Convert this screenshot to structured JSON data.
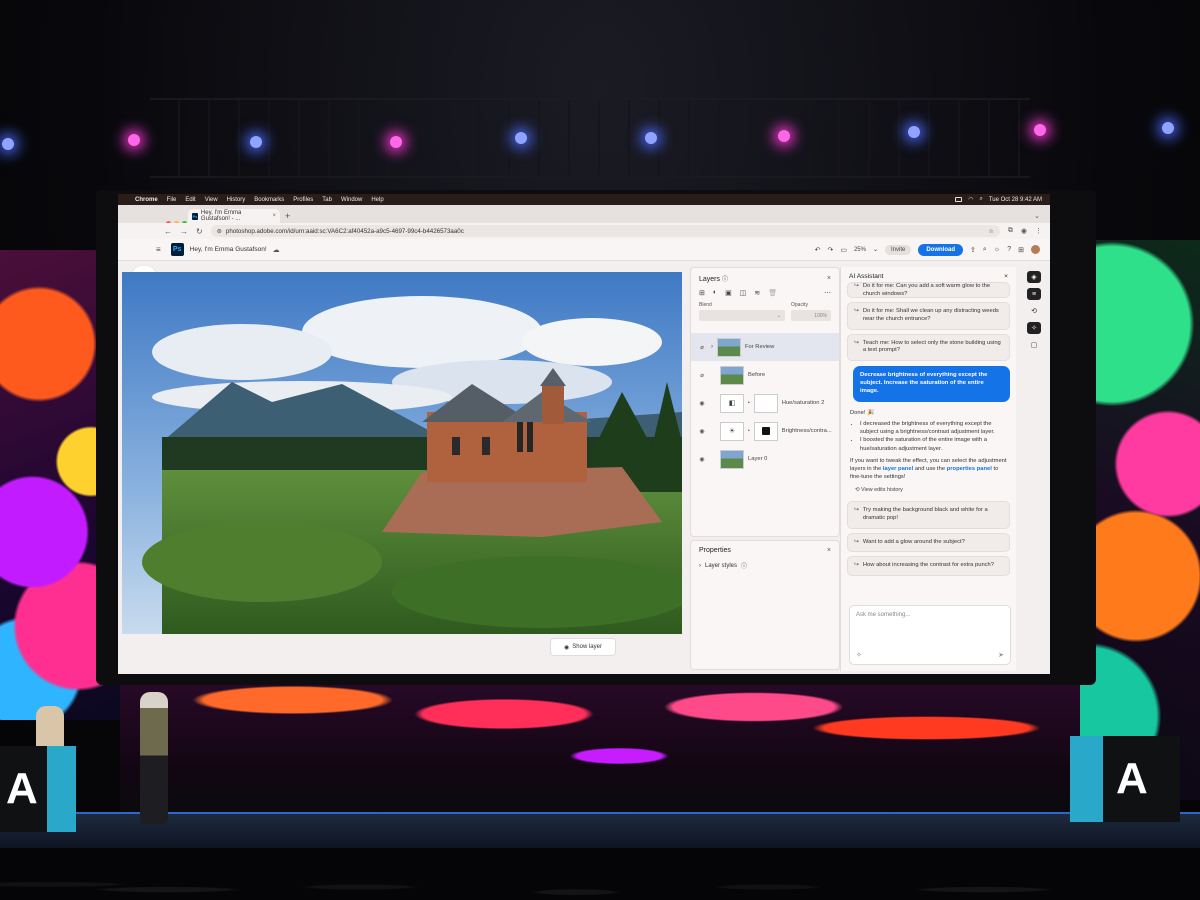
{
  "menubar": {
    "apple": "",
    "app": "Chrome",
    "items": [
      "File",
      "Edit",
      "View",
      "History",
      "Bookmarks",
      "Profiles",
      "Tab",
      "Window",
      "Help"
    ],
    "datetime": "Tue Oct 28  9:42 AM"
  },
  "browser": {
    "tab_title": "Hey, I'm Emma Gustafson! - ...",
    "favicon": "Ps",
    "url": "photoshop.adobe.com/id/urn:aaid:sc:VA6C2:af40452a-a9c5-4697-99c4-b4426573aa0c"
  },
  "ps_header": {
    "logo": "Ps",
    "title": "Hey, I'm Emma Gustafson!",
    "zoom": "25%",
    "invite": "Invite",
    "download": "Download"
  },
  "toolbar": {
    "tools": [
      "select-icon",
      "quick-select-icon",
      "object-select-icon",
      "brush-select-icon",
      "healing-icon",
      "clone-icon",
      "fill-icon",
      "crop-icon",
      "shape-icon",
      "type-icon",
      "pen-icon",
      "eyedropper-icon",
      "ellipse-icon",
      "swap-icon",
      "color-swatch"
    ]
  },
  "canvas": {
    "show_layer": "Show layer"
  },
  "layers_panel": {
    "title": "Layers",
    "blend_label": "Blend",
    "opacity_label": "Opacity",
    "opacity_value": "100%",
    "layers": [
      {
        "name": "For Review",
        "selected": true
      },
      {
        "name": "Before",
        "selected": false
      },
      {
        "name": "Hue/saturation 2",
        "selected": false
      },
      {
        "name": "Brightness/contra...",
        "selected": false
      },
      {
        "name": "Layer 0",
        "selected": false
      }
    ]
  },
  "properties_panel": {
    "title": "Properties",
    "layer_styles": "Layer styles"
  },
  "ai_assistant": {
    "title": "AI Assistant",
    "top_partial": "Do it for me: Can you add a soft warm glow to the church windows?",
    "chips": [
      "Do it for me: Shall we clean up any distracting weeds near the church entrance?",
      "Teach me: How to select only the stone building using a text prompt?"
    ],
    "user_message": "Decrease brightness of everything except the subject. Increase the saturation of the entire image.",
    "done": "Done! 🎉",
    "bullets": [
      "I decreased the brightness of everything except the subject using a brightness/contrast adjustment layer.",
      "I boosted the saturation of the entire image with a hue/saturation adjustment layer."
    ],
    "tweak_pre": "If you want to tweak the effect, you can select the adjustment layers in the",
    "layer_panel_link": "layer panel",
    "tweak_mid": "and use the",
    "properties_panel_link": "properties panel",
    "tweak_post": "to fine-tune the settings!",
    "view_edits": "View edits history",
    "suggestions": [
      "Try making the background black and white for a dramatic pop!",
      "Want to add a glow around the subject?",
      "How about increasing the contrast for extra punch?"
    ],
    "input_placeholder": "Ask me something..."
  },
  "podium_logo": "A"
}
